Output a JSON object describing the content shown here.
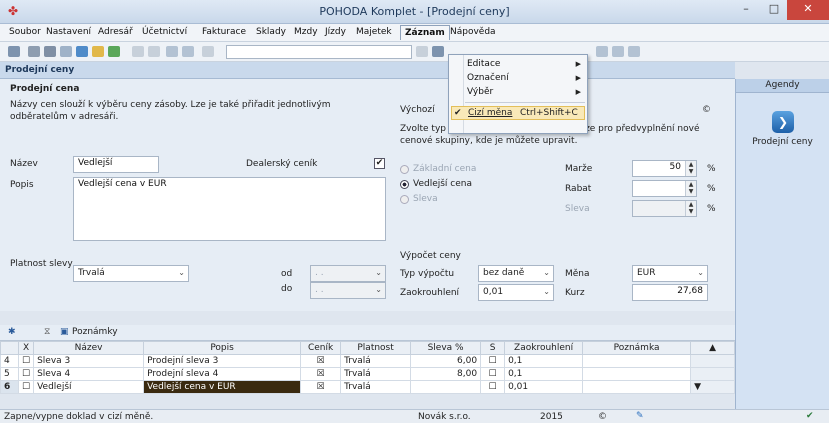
{
  "window": {
    "title": "POHODA Komplet - [Prodejní ceny]",
    "minimize": "–",
    "maximize": "□",
    "close": "✕"
  },
  "menu": [
    "Soubor",
    "Nastavení",
    "Adresář",
    "Účetnictví",
    "Fakturace",
    "Sklady",
    "Mzdy",
    "Jízdy",
    "Majetek",
    "Záznam",
    "Nápověda"
  ],
  "popup": {
    "items": [
      "Editace",
      "Označení",
      "Výběr"
    ],
    "checked_item": "Cizí měna",
    "checked_shortcut": "Ctrl+Shift+C"
  },
  "section_title": "Prodejní ceny",
  "left": {
    "group_title": "Prodejní cena",
    "description": "Názvy cen slouží k výběru ceny zásoby. Lze je také přiřadit jednotlivým odběratelům v adresáři.",
    "nazev_label": "Název",
    "nazev_value": "Vedlejší",
    "dealer_label": "Dealerský ceník",
    "popis_label": "Popis",
    "popis_value": "Vedlejší cena v EUR",
    "platnost_label": "Platnost slevy",
    "platnost_value": "Trvalá",
    "od_label": "od",
    "do_label": "do",
    "date_placeholder": ". ."
  },
  "right": {
    "group_title": "Výchozí",
    "description": "Zvolte typ ceny. Další hodnoty slouží pouze pro předvyplnění nové cenové skupiny, kde je můžete upravit.",
    "radio_zakladni": "Základní cena",
    "radio_vedlejsi": "Vedlejší cena",
    "radio_sleva": "Sleva",
    "marze_label": "Marže",
    "marze_value": "50",
    "rabat_label": "Rabat",
    "sleva_label": "Sleva",
    "percent": "%",
    "vypocet_title": "Výpočet ceny",
    "typ_label": "Typ výpočtu",
    "typ_value": "bez daně",
    "mena_label": "Měna",
    "mena_value": "EUR",
    "zaokr_label": "Zaokrouhlení",
    "zaokr_value": "0,01",
    "kurz_label": "Kurz",
    "kurz_value": "27,68",
    "copyright": "©"
  },
  "grid_toolbar": {
    "poznamky": "Poznámky"
  },
  "table": {
    "headers": [
      "X",
      "Název",
      "Popis",
      "Ceník",
      "Platnost",
      "Sleva %",
      "S",
      "Zaokrouhlení",
      "Poznámka"
    ],
    "rows": [
      {
        "num": "4",
        "nazev": "Sleva 3",
        "popis": "Prodejní sleva 3",
        "platnost": "Trvalá",
        "sleva": "6,00",
        "zaokr": "0,1"
      },
      {
        "num": "5",
        "nazev": "Sleva 4",
        "popis": "Prodejní sleva 4",
        "platnost": "Trvalá",
        "sleva": "8,00",
        "zaokr": "0,1"
      },
      {
        "num": "6",
        "nazev": "Vedlejší",
        "popis": "Vedlejší cena v EUR",
        "platnost": "Trvalá",
        "sleva": "",
        "zaokr": "0,01"
      }
    ]
  },
  "agendy": {
    "title": "Agendy",
    "item": "Prodejní ceny"
  },
  "status": {
    "message": "Zapne/vypne doklad v cizí měně.",
    "company": "Novák s.r.o.",
    "year": "2015",
    "copyright": "©"
  }
}
